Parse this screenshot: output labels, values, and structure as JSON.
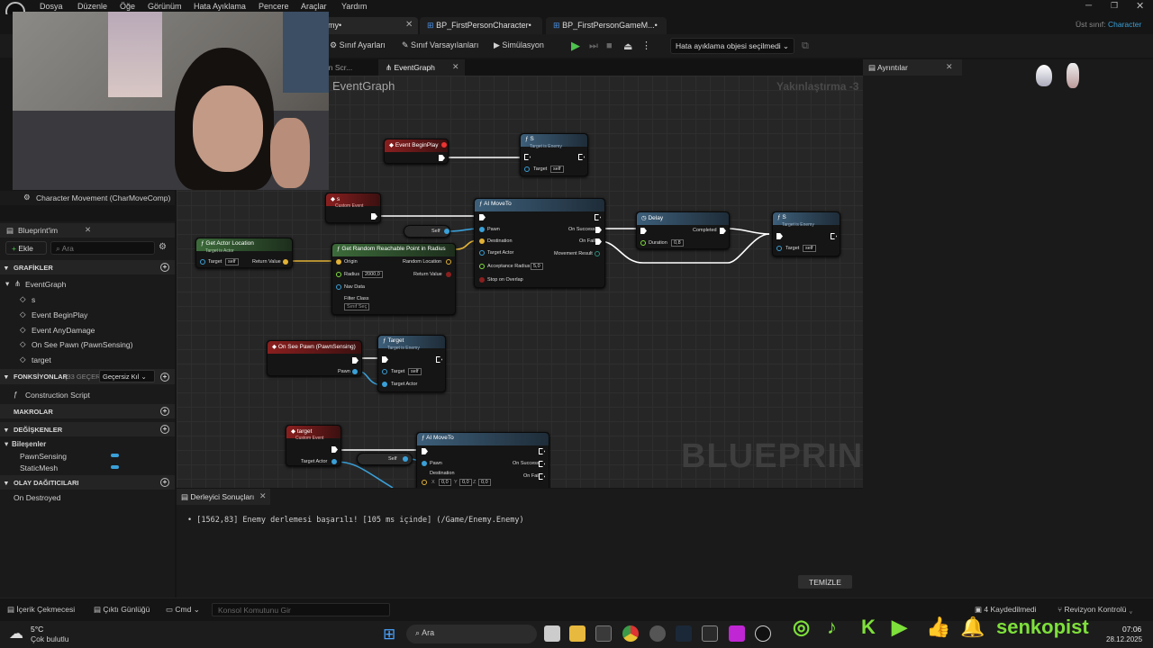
{
  "menu": {
    "items": [
      "Dosya",
      "Düzenle",
      "Öğe",
      "Görünüm",
      "Hata Ayıklama",
      "Pencere",
      "Araçlar",
      "Yardım"
    ]
  },
  "tabs": {
    "active": "my•",
    "items": [
      "BP_FirstPersonCharacter•",
      "BP_FirstPersonGameM...•"
    ],
    "parent_class_label": "Üst sınıf:",
    "parent_class_value": "Character"
  },
  "toolbar": {
    "class_settings": "Sınıf Ayarları",
    "class_defaults": "Sınıf Varsayılanları",
    "simulation": "Simülasyon",
    "debug_object": "Hata ayıklama objesi seçilmedi"
  },
  "graph_tabs": {
    "construction": "on Scr...",
    "event_graph": "EventGraph"
  },
  "details": {
    "title": "Ayrıntılar"
  },
  "components": {
    "char_movement": "Character Movement (CharMoveComp)"
  },
  "my_blueprint": {
    "title": "Blueprint'im",
    "add_label": "Ekle",
    "search_placeholder": "Ara",
    "sections": {
      "graphs": "GRAFİKLER",
      "functions": "FONKSİYONLAR",
      "functions_count": "(33 GEÇERSİ",
      "override_label": "Geçersiz Kıl",
      "macros": "MAKROLAR",
      "variables": "DEĞİŞKENLER",
      "components_label": "Bileşenler",
      "dispatchers": "OLAY DAĞITICILARI"
    },
    "graph_items": [
      "EventGraph",
      "s",
      "Event BeginPlay",
      "Event AnyDamage",
      "On See Pawn (PawnSensing)",
      "target"
    ],
    "function_items": [
      "Construction Script"
    ],
    "component_vars": [
      "PawnSensing",
      "StaticMesh"
    ],
    "dispatcher_items": [
      "On Destroyed"
    ]
  },
  "graph": {
    "title": "EventGraph",
    "zoom": "Yakınlaştırma -3",
    "watermark": "BLUEPRINT",
    "nodes": {
      "begin_play": "Event BeginPlay",
      "s_call_1": "S",
      "s_call_1_sub": "Target is Enemy",
      "target_label": "Target",
      "self_label": "self",
      "s_event": "s",
      "custom_event_sub": "Custom Event",
      "ai_move_to": "AI MoveTo",
      "pawn": "Pawn",
      "destination": "Destination",
      "target_actor": "Target Actor",
      "acceptance_radius": "Acceptance Radius",
      "acceptance_value": "5,0",
      "stop_on_overlap": "Stop on Overlap",
      "on_success": "On Success",
      "on_fail": "On Fail",
      "movement_result": "Movement Result",
      "delay": "Delay",
      "completed": "Completed",
      "duration": "Duration",
      "duration_value": "0,8",
      "s_call_2": "S",
      "get_actor_location": "Get Actor Location",
      "get_actor_location_sub": "Target is Actor",
      "return_value": "Return Value",
      "random_point": "Get Random Reachable Point in Radius",
      "origin": "Origin",
      "random_location": "Random Location",
      "radius": "Radius",
      "radius_value": "2000,0",
      "nav_data": "Nav Data",
      "filter_class": "Filter Class",
      "filter_select": "Sınıf Seç",
      "self_node": "Self",
      "on_see_pawn": "On See Pawn (PawnSensing)",
      "target_call": "Target",
      "target_call_sub": "Target is Enemy",
      "target_event": "target",
      "ai_move_to_2": "AI MoveTo",
      "destination_values": [
        "0,0",
        "0,0",
        "0,0"
      ],
      "axis_x": "X",
      "axis_y": "Y",
      "axis_z": "Z"
    }
  },
  "compiler": {
    "tab_title": "Derleyici Sonuçları",
    "message": "[1562,83] Enemy derlemesi başarılı! [105 ms içinde] (/Game/Enemy.Enemy)",
    "clear_button": "TEMİZLE"
  },
  "status": {
    "content_drawer": "İçerik Çekmecesi",
    "output_log": "Çıktı Günlüğü",
    "cmd": "Cmd",
    "console_placeholder": "Konsol Komutunu Gir",
    "saved": "4 Kaydedilmedi",
    "revision": "Revizyon Kontrolü"
  },
  "taskbar": {
    "temperature": "5°C",
    "weather": "Çok bulutlu",
    "search": "Ara",
    "time": "07:06",
    "date": "28.12.2025",
    "channel": "senkopist"
  },
  "colors": {
    "accent_blue": "#3aa0d8",
    "social_green": "#7ee03b"
  }
}
